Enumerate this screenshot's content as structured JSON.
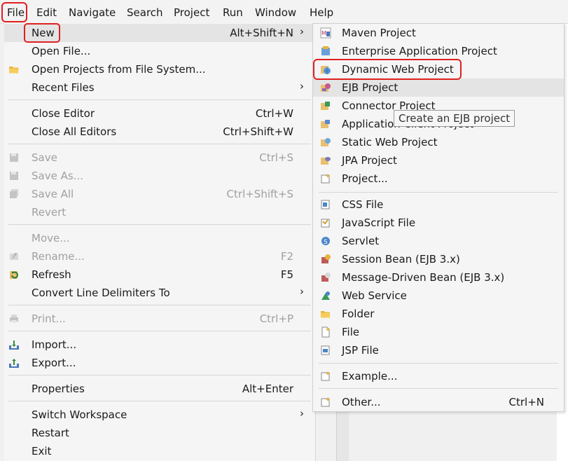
{
  "menubar": {
    "items": [
      "File",
      "Edit",
      "Navigate",
      "Search",
      "Project",
      "Run",
      "Window",
      "Help"
    ]
  },
  "file_menu": {
    "new": {
      "label": "New",
      "shortcut": "Alt+Shift+N"
    },
    "open_file": {
      "label": "Open File..."
    },
    "open_projects": {
      "label": "Open Projects from File System..."
    },
    "recent_files": {
      "label": "Recent Files"
    },
    "close_editor": {
      "label": "Close Editor",
      "shortcut": "Ctrl+W"
    },
    "close_all_editors": {
      "label": "Close All Editors",
      "shortcut": "Ctrl+Shift+W"
    },
    "save": {
      "label": "Save",
      "shortcut": "Ctrl+S"
    },
    "save_as": {
      "label": "Save As..."
    },
    "save_all": {
      "label": "Save All",
      "shortcut": "Ctrl+Shift+S"
    },
    "revert": {
      "label": "Revert"
    },
    "move": {
      "label": "Move..."
    },
    "rename": {
      "label": "Rename...",
      "shortcut": "F2"
    },
    "refresh": {
      "label": "Refresh",
      "shortcut": "F5"
    },
    "convert": {
      "label": "Convert Line Delimiters To"
    },
    "print": {
      "label": "Print...",
      "shortcut": "Ctrl+P"
    },
    "import": {
      "label": "Import..."
    },
    "export": {
      "label": "Export..."
    },
    "properties": {
      "label": "Properties",
      "shortcut": "Alt+Enter"
    },
    "switch_workspace": {
      "label": "Switch Workspace"
    },
    "restart": {
      "label": "Restart"
    },
    "exit": {
      "label": "Exit"
    }
  },
  "new_menu": {
    "maven": {
      "label": "Maven Project",
      "icon": "maven-icon"
    },
    "enterprise": {
      "label": "Enterprise Application Project",
      "icon": "ear-icon"
    },
    "dynamic_web": {
      "label": "Dynamic Web Project",
      "icon": "web-project-icon"
    },
    "ejb": {
      "label": "EJB Project",
      "icon": "ejb-icon"
    },
    "connector": {
      "label": "Connector Project",
      "icon": "connector-icon"
    },
    "application_client": {
      "label": "Application Client Project",
      "icon": "app-client-icon"
    },
    "static_web": {
      "label": "Static Web Project",
      "icon": "static-web-icon"
    },
    "jpa": {
      "label": "JPA Project",
      "icon": "jpa-icon"
    },
    "project": {
      "label": "Project...",
      "icon": "project-icon"
    },
    "css": {
      "label": "CSS File",
      "icon": "css-icon"
    },
    "javascript": {
      "label": "JavaScript File",
      "icon": "javascript-icon"
    },
    "servlet": {
      "label": "Servlet",
      "icon": "servlet-icon"
    },
    "session_bean": {
      "label": "Session Bean (EJB 3.x)",
      "icon": "session-bean-icon"
    },
    "mdb": {
      "label": "Message-Driven Bean (EJB 3.x)",
      "icon": "mdb-icon"
    },
    "web_service": {
      "label": "Web Service",
      "icon": "web-service-icon"
    },
    "folder": {
      "label": "Folder",
      "icon": "folder-icon"
    },
    "file": {
      "label": "File",
      "icon": "file-icon"
    },
    "jsp": {
      "label": "JSP File",
      "icon": "jsp-icon"
    },
    "example": {
      "label": "Example...",
      "icon": "example-icon"
    },
    "other": {
      "label": "Other...",
      "shortcut": "Ctrl+N",
      "icon": "other-icon"
    }
  },
  "tooltip": {
    "text": "Create an EJB project"
  },
  "colors": {
    "highlight_border": "#e02020",
    "menu_bg": "#f5f5f5",
    "hover_bg": "#e4e4e4"
  }
}
